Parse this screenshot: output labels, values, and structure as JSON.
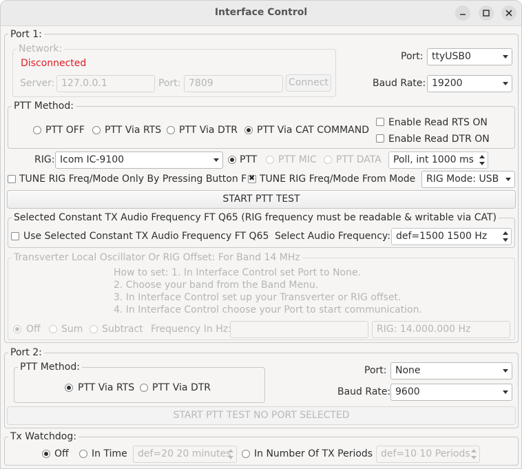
{
  "window": {
    "title": "Interface Control"
  },
  "port1": {
    "legend": "Port 1:",
    "network": {
      "legend": "Network:",
      "status": "Disconnected",
      "server_label": "Server:",
      "server_value": "127.0.0.1",
      "port_label": "Port:",
      "port_value": "7809",
      "connect_label": "Connect"
    },
    "port_label": "Port:",
    "port_value": "ttyUSB0",
    "baud_label": "Baud Rate:",
    "baud_value": "19200",
    "ptt": {
      "legend": "PTT Method:",
      "options": [
        "PTT OFF",
        "PTT Via RTS",
        "PTT Via DTR",
        "PTT Via CAT COMMAND"
      ],
      "selected": "PTT Via CAT COMMAND",
      "rts_on": "Enable Read RTS ON",
      "dtr_on": "Enable Read DTR ON"
    },
    "rig_label": "RIG:",
    "rig_value": "Icom IC-9100",
    "ptt_modes": [
      "PTT",
      "PTT MIC",
      "PTT DATA"
    ],
    "poll_value": "Poll, int  1000  ms",
    "tune_button_only": "TUNE RIG Freq/Mode Only By Pressing Button F",
    "tune_from_mode": "TUNE RIG Freq/Mode From Mode",
    "rig_mode_value": "RIG Mode: USB",
    "start_ptt_test": "START PTT TEST"
  },
  "constant_tx": {
    "legend": "Selected Constant TX  Audio Frequency FT Q65 (RIG frequency must be readable & writable via CAT)",
    "use_label": "Use Selected Constant TX  Audio Frequency FT Q65",
    "select_label": "Select  Audio Frequency:",
    "freq_value": "def=1500  1500  Hz"
  },
  "transverter": {
    "legend": "Transverter Local Oscillator Or RIG Offset:   For Band 14 MHz",
    "howto": [
      "How to set: 1. In Interface Control set Port to None.",
      "2. Choose your band from the Band Menu.",
      "3. In Interface Control set up your Transverter or RIG offset.",
      "4. In Interface Control choose your Port to start communication."
    ],
    "options": [
      "Off",
      "Sum",
      "Subtract"
    ],
    "freq_label": "Frequency In Hz:",
    "rig_value": "RIG: 14.000.000 Hz"
  },
  "port2": {
    "legend": "Port 2:",
    "ptt": {
      "legend": "PTT Method:",
      "options": [
        "PTT Via RTS",
        "PTT Via DTR"
      ]
    },
    "port_label": "Port:",
    "port_value": "None",
    "baud_label": "Baud Rate:",
    "baud_value": "9600",
    "start_test": "START PTT TEST    NO PORT SELECTED"
  },
  "watchdog": {
    "legend": "Tx Watchdog:",
    "off": "Off",
    "in_time": "In Time",
    "time_value": "def=20  20  minutes",
    "in_periods": "In Number Of TX Periods",
    "periods_value": "def=10  10  Periods"
  }
}
